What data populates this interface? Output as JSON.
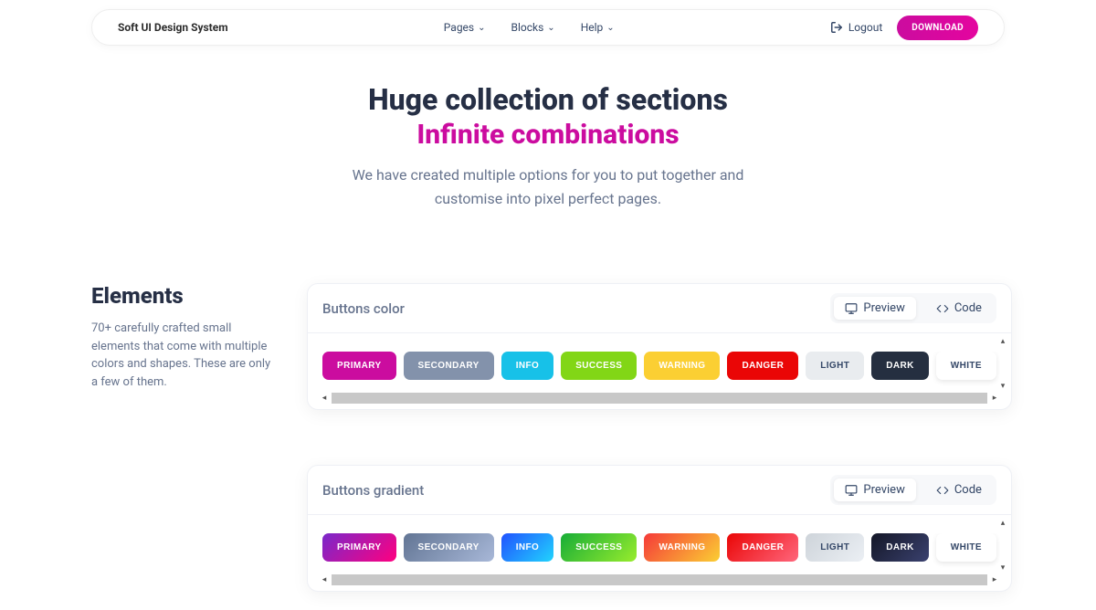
{
  "navbar": {
    "brand": "Soft UI Design System",
    "links": [
      {
        "label": "Pages"
      },
      {
        "label": "Blocks"
      },
      {
        "label": "Help"
      }
    ],
    "logout_label": "Logout",
    "download_label": "DOWNLOAD"
  },
  "hero": {
    "title": "Huge collection of sections",
    "subtitle": "Infinite combinations",
    "desc_line1": "We have created multiple options for you to put together and",
    "desc_line2": "customise into pixel perfect pages."
  },
  "sidebar": {
    "title": "Elements",
    "desc": "70+ carefully crafted small elements that come with multiple colors and shapes. These are only a few of them."
  },
  "panels": {
    "preview_label": "Preview",
    "code_label": "Code",
    "colors_title": "Buttons color",
    "gradients_title": "Buttons gradient",
    "buttons": [
      {
        "label": "PRIMARY"
      },
      {
        "label": "SECONDARY"
      },
      {
        "label": "INFO"
      },
      {
        "label": "SUCCESS"
      },
      {
        "label": "WARNING"
      },
      {
        "label": "DANGER"
      },
      {
        "label": "LIGHT"
      },
      {
        "label": "DARK"
      },
      {
        "label": "WHITE"
      }
    ]
  }
}
